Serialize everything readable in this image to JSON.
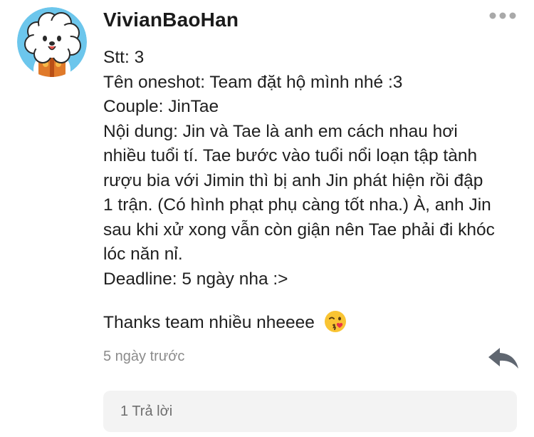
{
  "comment": {
    "author": "VivianBaoHan",
    "avatar_icon": "bt21-rj-avatar",
    "body_lines": [
      "Stt: 3",
      "Tên oneshot: Team đặt hộ mình nhé :3",
      "Couple: JinTae",
      "Nội dung: Jin và Tae là anh em cách nhau hơi",
      "nhiều tuổi tí. Tae bước vào tuổi nổi loạn tập tành",
      "rượu bia với Jimin thì bị anh Jin phát hiện rồi đập",
      "1 trận. (Có hình phạt phụ càng tốt nha.) À, anh Jin",
      "sau khi xử xong vẫn còn giận nên Tae phải đi khóc",
      "lóc năn nỉ.",
      "Deadline: 5 ngày nha :>"
    ],
    "thanks_text": "Thanks team nhiều nheeee",
    "emoji_icon": "face-blowing-kiss-emoji",
    "timestamp": "5 ngày trước",
    "more_icon": "more-dots-icon",
    "reply_icon": "reply-arrow-icon",
    "replies_label": "1 Trả lời"
  },
  "colors": {
    "avatar_bg": "#6cc6ec",
    "text": "#1f1f1f",
    "muted": "#8b8b8b",
    "reply_box_bg": "#f3f3f3"
  }
}
